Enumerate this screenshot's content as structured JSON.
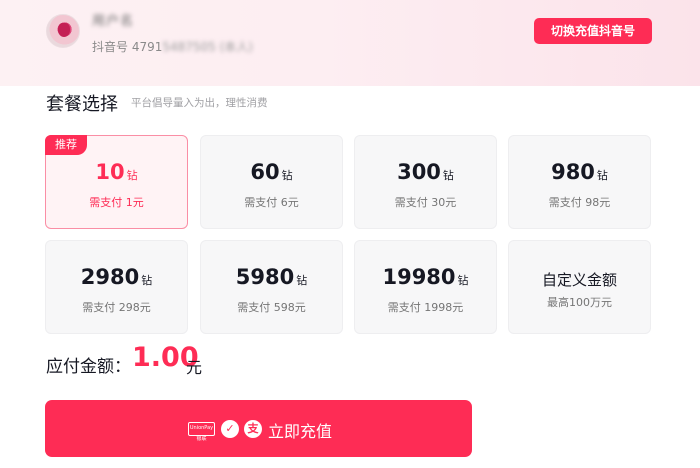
{
  "header": {
    "username": "用户名",
    "user_id_prefix": "抖音号 4791",
    "user_id_hidden": "5487505 (本人)",
    "switch_button": "切换充值抖音号"
  },
  "section": {
    "title": "套餐选择",
    "subtitle": "平台倡导量入为出，理性消费"
  },
  "packages": [
    {
      "num": "10",
      "unit": "钻",
      "pay": "需支付 1元",
      "badge": "推荐",
      "selected": true
    },
    {
      "num": "60",
      "unit": "钻",
      "pay": "需支付 6元"
    },
    {
      "num": "300",
      "unit": "钻",
      "pay": "需支付 30元"
    },
    {
      "num": "980",
      "unit": "钻",
      "pay": "需支付 98元"
    },
    {
      "num": "2980",
      "unit": "钻",
      "pay": "需支付 298元"
    },
    {
      "num": "5980",
      "unit": "钻",
      "pay": "需支付 598元"
    },
    {
      "num": "19980",
      "unit": "钻",
      "pay": "需支付 1998元"
    }
  ],
  "custom": {
    "title": "自定义金额",
    "subtitle": "最高100万元"
  },
  "total": {
    "label": "应付金额：",
    "value": "1.00",
    "unit": "元"
  },
  "pay_button": {
    "label": "立即充值",
    "icons": [
      "unionpay-icon",
      "wechat-pay-icon",
      "alipay-icon"
    ],
    "unionpay_text": "UnionPay 银联"
  },
  "colors": {
    "accent": "#fe2c55",
    "card_bg": "#f7f7f8",
    "selected_bg": "#fff3f5"
  }
}
